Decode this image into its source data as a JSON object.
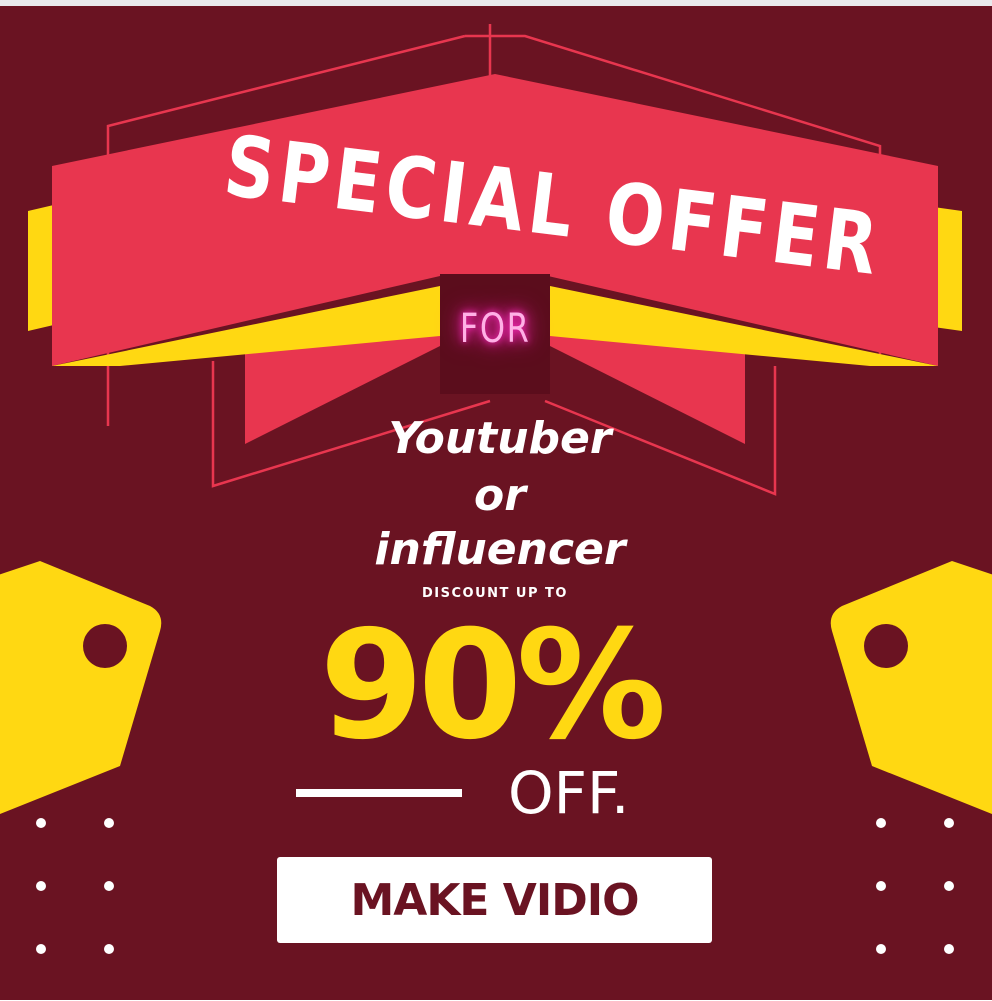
{
  "banner": {
    "title": "SPECIAL OFFER",
    "connector": "FOR",
    "line1": "Youtuber",
    "line2": "or",
    "line3": "influencer",
    "discount_label": "DISCOUNT UP TO",
    "percent": "90%",
    "off_label": "OFF.",
    "cta_label": "MAKE VIDIO"
  },
  "colors": {
    "background": "#6a1322",
    "ribbon_red": "#e8364f",
    "ribbon_yellow": "#ffd812",
    "neon_pink": "#ff2bbf",
    "text_white": "#ffffff"
  },
  "icons": [
    "price-tag-icon",
    "price-tag-icon"
  ]
}
